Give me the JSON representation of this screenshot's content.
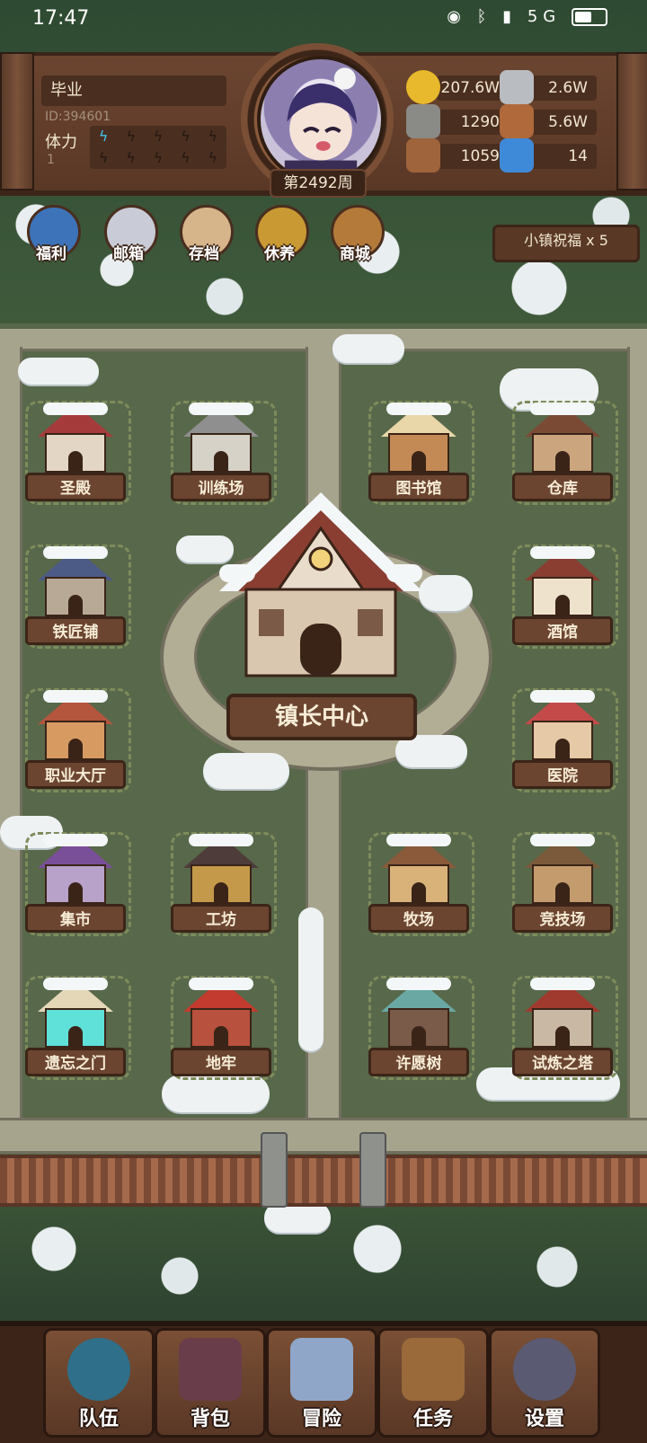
{
  "status_bar": {
    "time": "17:47",
    "network": "5G"
  },
  "player": {
    "name": "毕业",
    "id": "ID:394601",
    "stamina_label": "体力",
    "stamina_sub": "1",
    "stamina_filled": 1,
    "stamina_total": 10,
    "week": "第2492周"
  },
  "resources": [
    {
      "icon": "gold-coin-icon",
      "value": "207.6W"
    },
    {
      "icon": "iron-ingot-icon",
      "value": "2.6W"
    },
    {
      "icon": "stone-icon",
      "value": "1290"
    },
    {
      "icon": "leather-icon",
      "value": "5.6W"
    },
    {
      "icon": "wood-log-icon",
      "value": "1059"
    },
    {
      "icon": "blue-crystal-icon",
      "value": "14"
    }
  ],
  "quick_menu": [
    {
      "name": "welfare",
      "label": "福利",
      "icon": "shield-icon",
      "color": "#3d73b8"
    },
    {
      "name": "mailbox",
      "label": "邮箱",
      "icon": "mail-icon",
      "color": "#c9cbd6"
    },
    {
      "name": "save",
      "label": "存档",
      "icon": "scroll-quill-icon",
      "color": "#d7b58a"
    },
    {
      "name": "rest",
      "label": "休养",
      "icon": "book-icon",
      "color": "#c99a33"
    },
    {
      "name": "shop",
      "label": "商城",
      "icon": "treasure-icon",
      "color": "#b37a3a"
    }
  ],
  "blessing": "小镇祝福 x 5",
  "center_building": "镇长中心",
  "buildings": [
    {
      "name": "holy-hall",
      "label": "圣殿",
      "roof": "#a53b3b",
      "wall": "#e3d6c4"
    },
    {
      "name": "training-ground",
      "label": "训练场",
      "roof": "#8f8f8f",
      "wall": "#d6d2c8"
    },
    {
      "name": "library",
      "label": "图书馆",
      "roof": "#e9d7a9",
      "wall": "#c48a55"
    },
    {
      "name": "warehouse",
      "label": "仓库",
      "roof": "#7a4a35",
      "wall": "#caa57d"
    },
    {
      "name": "blacksmith",
      "label": "铁匠铺",
      "roof": "#4c5a86",
      "wall": "#b8a996"
    },
    {
      "name": "tavern",
      "label": "酒馆",
      "roof": "#8a3e32",
      "wall": "#efe2cd"
    },
    {
      "name": "job-hall",
      "label": "职业大厅",
      "roof": "#b4553e",
      "wall": "#d79b62"
    },
    {
      "name": "hospital",
      "label": "医院",
      "roof": "#c44a4a",
      "wall": "#e6c9a6"
    },
    {
      "name": "market",
      "label": "集市",
      "roof": "#7a4f9a",
      "wall": "#b8a2c9"
    },
    {
      "name": "workshop",
      "label": "工坊",
      "roof": "#4d3c3a",
      "wall": "#c49a4a"
    },
    {
      "name": "ranch",
      "label": "牧场",
      "roof": "#8a5a3a",
      "wall": "#d9b27a"
    },
    {
      "name": "arena",
      "label": "竞技场",
      "roof": "#7a5a3a",
      "wall": "#c49b6d"
    },
    {
      "name": "forgotten-gate",
      "label": "遗忘之门",
      "roof": "#e3d7b8",
      "wall": "#5fe0d8"
    },
    {
      "name": "dungeon",
      "label": "地牢",
      "roof": "#c23b2e",
      "wall": "#b8513d"
    },
    {
      "name": "wishing-tree",
      "label": "许愿树",
      "roof": "#6aa8a4",
      "wall": "#7a5a48"
    },
    {
      "name": "trial-tower",
      "label": "试炼之塔",
      "roof": "#a13a2e",
      "wall": "#c9b9a4"
    }
  ],
  "nav": [
    {
      "name": "team",
      "label": "队伍",
      "icon": "helmet-icon",
      "color": "#2f6f89"
    },
    {
      "name": "bag",
      "label": "背包",
      "icon": "backpack-icon",
      "color": "#6a3d4a"
    },
    {
      "name": "adventure",
      "label": "冒险",
      "icon": "crossed-swords-icon",
      "color": "#8fa6c9"
    },
    {
      "name": "quest",
      "label": "任务",
      "icon": "quest-scroll-icon",
      "color": "#9a6a3a"
    },
    {
      "name": "settings",
      "label": "设置",
      "icon": "gear-icon",
      "color": "#5a5a72"
    }
  ]
}
